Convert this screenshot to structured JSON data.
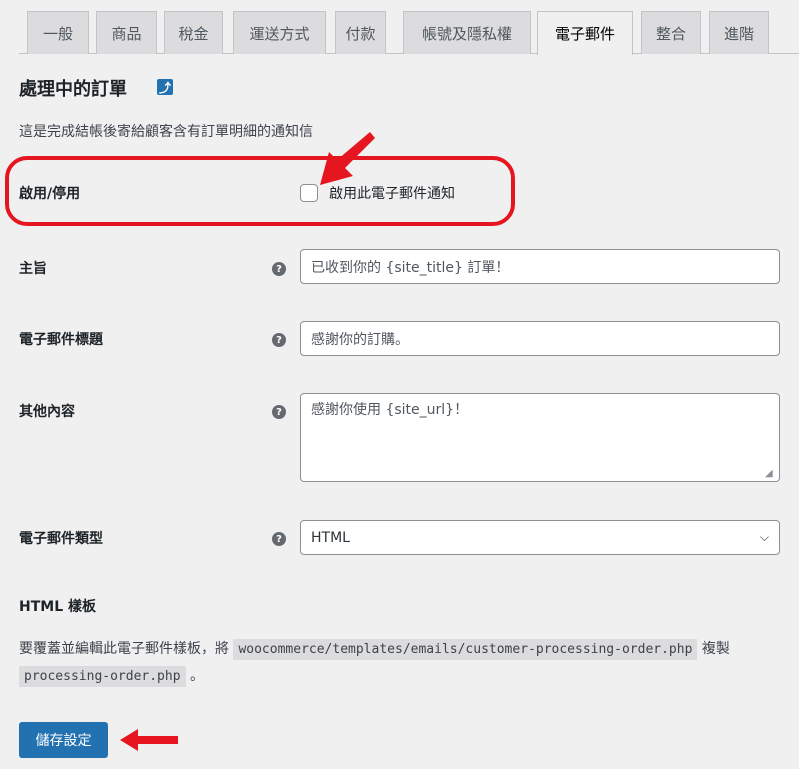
{
  "tabs": [
    {
      "label": "一般"
    },
    {
      "label": "商品"
    },
    {
      "label": "稅金"
    },
    {
      "label": "運送方式"
    },
    {
      "label": "付款"
    },
    {
      "label": "帳號及隱私權"
    },
    {
      "label": "電子郵件",
      "active": true
    },
    {
      "label": "整合"
    },
    {
      "label": "進階"
    }
  ],
  "heading": "處理中的訂單",
  "back_icon": "return-arrow-icon",
  "description": "這是完成結帳後寄給顧客含有訂單明細的通知信",
  "enable": {
    "label": "啟用/停用",
    "checkbox_label": "啟用此電子郵件通知",
    "checked": false
  },
  "subject": {
    "label": "主旨",
    "value": "已收到你的 {site_title} 訂單！"
  },
  "email_heading": {
    "label": "電子郵件標題",
    "value": "感謝你的訂購。"
  },
  "additional": {
    "label": "其他內容",
    "value": "感謝你使用 {site_url}！"
  },
  "email_type": {
    "label": "電子郵件類型",
    "value": "HTML"
  },
  "template": {
    "title": "HTML 樣板",
    "text1": "要覆蓋並編輯此電子郵件樣板，將",
    "code1": "woocommerce/templates/emails/customer-processing-order.php",
    "text2": "複製",
    "code2": "processing-order.php",
    "text3": "。"
  },
  "save_label": "儲存設定",
  "colors": {
    "accent": "#2271b1",
    "annotation": "#e5161f"
  }
}
